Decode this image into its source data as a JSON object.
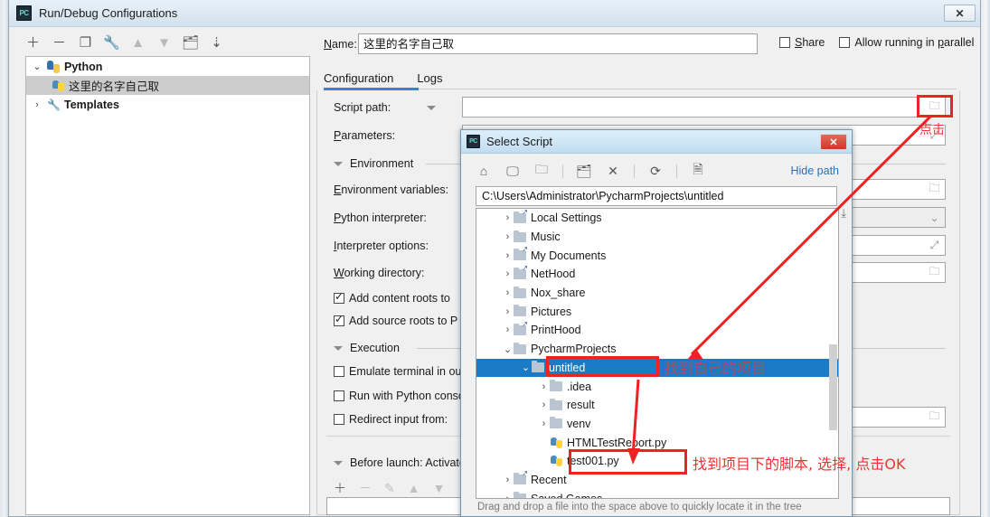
{
  "window": {
    "title": "Run/Debug Configurations",
    "logo": "pycharm-logo",
    "close_label": "✕"
  },
  "toolbar": {
    "icons": [
      {
        "name": "add-icon",
        "glyph": "＋",
        "dim": false
      },
      {
        "name": "remove-icon",
        "glyph": "－",
        "dim": false
      },
      {
        "name": "copy-icon",
        "glyph": "❐",
        "dim": false
      },
      {
        "name": "edit-templates-icon",
        "glyph": "🔧",
        "dim": false
      },
      {
        "name": "move-up-icon",
        "glyph": "▲",
        "dim": true
      },
      {
        "name": "move-down-icon",
        "glyph": "▼",
        "dim": true
      },
      {
        "name": "move-into-folder-icon",
        "glyph": "🗂",
        "dim": false
      },
      {
        "name": "sort-alphabetically-icon",
        "glyph": "↓≡",
        "dim": false
      }
    ]
  },
  "tree": {
    "items": [
      {
        "label": "Python",
        "icon": "python-icon",
        "chevron": "⌄",
        "bold": true,
        "indent": 0,
        "selected": false
      },
      {
        "label": "这里的名字自己取",
        "icon": "python-file-icon",
        "chevron": "",
        "bold": false,
        "indent": 1,
        "selected": true
      },
      {
        "label": "Templates",
        "icon": "wrench-icon",
        "chevron": "›",
        "bold": true,
        "indent": 0,
        "selected": false
      }
    ]
  },
  "name_field": {
    "label": "Name:",
    "label_mnemonic": "N",
    "value": "这里的名字自己取"
  },
  "options": [
    {
      "label": "Share",
      "mnemonic": "S",
      "checked": false,
      "name": "share-checkbox"
    },
    {
      "label": "Allow running in parallel",
      "mnemonic": "p",
      "checked": false,
      "name": "allow-parallel-checkbox"
    }
  ],
  "tabs": [
    {
      "label": "Configuration",
      "active": true
    },
    {
      "label": "Logs",
      "active": false
    }
  ],
  "config_form": {
    "fields": [
      {
        "label": "Script path:",
        "mnemonic": "",
        "has_caret": true,
        "name": "script-path-field",
        "icon": "folder-icon"
      },
      {
        "label": "Parameters:",
        "mnemonic": "P",
        "has_caret": false,
        "name": "parameters-field",
        "icon": "expand-icon"
      },
      {
        "label": "Environment variables:",
        "mnemonic": "E",
        "has_caret": false,
        "name": "environment-variables-field",
        "icon": "folder-icon"
      },
      {
        "label": "Python interpreter:",
        "mnemonic": "P",
        "has_caret": false,
        "name": "python-interpreter-field",
        "icon": "chevron-down-icon"
      },
      {
        "label": "Interpreter options:",
        "mnemonic": "I",
        "has_caret": false,
        "name": "interpreter-options-field",
        "icon": "expand-icon"
      },
      {
        "label": "Working directory:",
        "mnemonic": "W",
        "has_caret": false,
        "name": "working-directory-field",
        "icon": "folder-icon"
      }
    ],
    "sections": [
      {
        "label": "Environment"
      },
      {
        "label": "Execution"
      }
    ],
    "checkboxes": [
      {
        "label": "Add content roots to ",
        "checked": true,
        "name": "add-content-roots-checkbox"
      },
      {
        "label": "Add source roots to P",
        "checked": true,
        "name": "add-source-roots-checkbox"
      },
      {
        "label": "Emulate terminal in ou",
        "checked": false,
        "name": "emulate-terminal-checkbox"
      },
      {
        "label": "Run with Python conso",
        "checked": false,
        "name": "run-with-console-checkbox"
      },
      {
        "label": "Redirect input from:",
        "checked": false,
        "name": "redirect-input-checkbox"
      }
    ],
    "before_launch": {
      "label": "Before launch: Activate to",
      "mnemonic": "B",
      "toolbar": [
        {
          "name": "before-launch-add-icon",
          "glyph": "＋",
          "dim": false
        },
        {
          "name": "before-launch-remove-icon",
          "glyph": "－",
          "dim": true
        },
        {
          "name": "before-launch-edit-icon",
          "glyph": "✎",
          "dim": true
        },
        {
          "name": "before-launch-up-icon",
          "glyph": "▲",
          "dim": true
        },
        {
          "name": "before-launch-down-icon",
          "glyph": "▼",
          "dim": true
        }
      ]
    }
  },
  "dialog": {
    "title": "Select Script",
    "logo": "pycharm-logo",
    "close_label": "✕",
    "toolbar": [
      {
        "name": "home-icon",
        "glyph": "⌂"
      },
      {
        "name": "desktop-icon",
        "glyph": "🖵"
      },
      {
        "name": "project-folder-icon",
        "glyph": "🗀"
      },
      {
        "name": "new-folder-icon",
        "glyph": "🗂"
      },
      {
        "name": "delete-icon",
        "glyph": "✕"
      },
      {
        "name": "refresh-icon",
        "glyph": "⟳"
      },
      {
        "name": "show-hidden-icon",
        "glyph": "🗎"
      }
    ],
    "hide_path_label": "Hide path",
    "path_value": "C:\\Users\\Administrator\\PycharmProjects\\untitled",
    "path_dropdown_icon": "download-arrow-icon",
    "hint": "Drag and drop a file into the space above to quickly locate it in the tree",
    "tree": [
      {
        "label": "Local Settings",
        "chevron": "›",
        "indent": 1,
        "type": "folder-shortcut",
        "selected": false
      },
      {
        "label": "Music",
        "chevron": "›",
        "indent": 1,
        "type": "folder",
        "selected": false
      },
      {
        "label": "My Documents",
        "chevron": "›",
        "indent": 1,
        "type": "folder-shortcut",
        "selected": false
      },
      {
        "label": "NetHood",
        "chevron": "›",
        "indent": 1,
        "type": "folder-shortcut",
        "selected": false
      },
      {
        "label": "Nox_share",
        "chevron": "›",
        "indent": 1,
        "type": "folder",
        "selected": false
      },
      {
        "label": "Pictures",
        "chevron": "›",
        "indent": 1,
        "type": "folder",
        "selected": false
      },
      {
        "label": "PrintHood",
        "chevron": "›",
        "indent": 1,
        "type": "folder-shortcut",
        "selected": false
      },
      {
        "label": "PycharmProjects",
        "chevron": "⌄",
        "indent": 1,
        "type": "folder",
        "selected": false
      },
      {
        "label": "untitled",
        "chevron": "⌄",
        "indent": 2,
        "type": "folder",
        "selected": true
      },
      {
        "label": ".idea",
        "chevron": "›",
        "indent": 3,
        "type": "folder",
        "selected": false
      },
      {
        "label": "result",
        "chevron": "›",
        "indent": 3,
        "type": "folder",
        "selected": false
      },
      {
        "label": "venv",
        "chevron": "›",
        "indent": 3,
        "type": "folder",
        "selected": false
      },
      {
        "label": "HTMLTestReport.py",
        "chevron": "",
        "indent": 3,
        "type": "pyfile",
        "selected": false
      },
      {
        "label": "test001.py",
        "chevron": "",
        "indent": 3,
        "type": "pyfile",
        "selected": false
      },
      {
        "label": "Recent",
        "chevron": "›",
        "indent": 1,
        "type": "folder-shortcut",
        "selected": false
      },
      {
        "label": "Saved Games",
        "chevron": "›",
        "indent": 1,
        "type": "folder",
        "selected": false
      }
    ]
  },
  "annotations": {
    "color": "#ee2222",
    "items": [
      {
        "name": "annotation-click-browse",
        "text": "点击"
      },
      {
        "name": "annotation-find-project",
        "text": "找到自己的项目"
      },
      {
        "name": "annotation-find-script",
        "text": "找到项目下的脚本, 选择, 点击OK"
      }
    ]
  }
}
